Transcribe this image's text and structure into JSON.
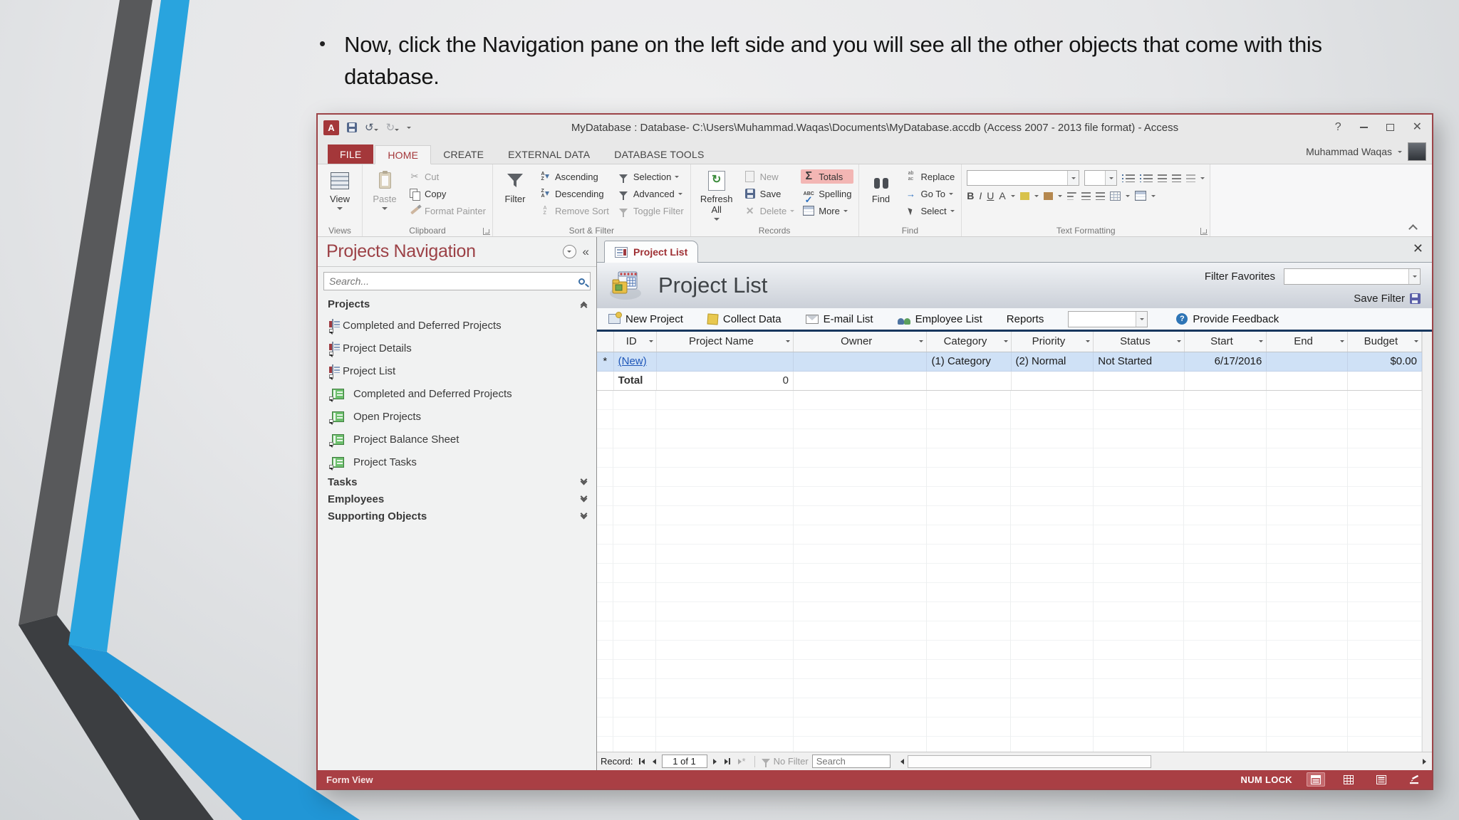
{
  "slide": {
    "bullet_glyph": "•",
    "bullet": "Now, click the Navigation pane on the left side and you will see all the other objects that come with this database."
  },
  "titlebar": {
    "title": "MyDatabase : Database- C:\\Users\\Muhammad.Waqas\\Documents\\MyDatabase.accdb (Access 2007 - 2013 file format) - Access",
    "help": "?"
  },
  "tabs": {
    "file": "FILE",
    "home": "HOME",
    "create": "CREATE",
    "external_data": "EXTERNAL DATA",
    "database_tools": "DATABASE TOOLS"
  },
  "account": {
    "user": "Muhammad Waqas"
  },
  "ribbon": {
    "views": {
      "label": "Views",
      "view": "View"
    },
    "clipboard": {
      "label": "Clipboard",
      "paste": "Paste",
      "cut": "Cut",
      "copy": "Copy",
      "format_painter": "Format Painter"
    },
    "sort_filter": {
      "label": "Sort & Filter",
      "filter": "Filter",
      "ascending": "Ascending",
      "descending": "Descending",
      "remove_sort": "Remove Sort",
      "selection": "Selection",
      "advanced": "Advanced",
      "toggle_filter": "Toggle Filter"
    },
    "records": {
      "label": "Records",
      "refresh_all": "Refresh All",
      "new": "New",
      "save": "Save",
      "delete": "Delete",
      "totals": "Totals",
      "spelling": "Spelling",
      "more": "More"
    },
    "find": {
      "label": "Find",
      "find": "Find",
      "replace": "Replace",
      "goto": "Go To",
      "select": "Select"
    },
    "text_formatting": {
      "label": "Text Formatting"
    }
  },
  "icons": {
    "access_logo": "A",
    "undo": "↺",
    "redo": "↻",
    "cut": "✂",
    "refresh": "↻",
    "sigma": "Σ",
    "abc": "ABC",
    "check": "✓",
    "delete_x": "✕",
    "goto_arrow": "→",
    "bold": "B",
    "italic": "I",
    "underline": "U",
    "font_color": "A",
    "question": "?",
    "pane_collapse": "«",
    "az_a": "A",
    "az_z": "Z"
  },
  "navpane": {
    "title": "Projects Navigation",
    "search_placeholder": "Search...",
    "projects_group": "Projects",
    "items": [
      {
        "label": "Completed and Deferred Projects",
        "icon": "form-icon"
      },
      {
        "label": "Project Details",
        "icon": "form-icon"
      },
      {
        "label": "Project List",
        "icon": "form-icon"
      },
      {
        "label": "Completed and Deferred Projects",
        "icon": "report-icon"
      },
      {
        "label": "Open Projects",
        "icon": "report-icon"
      },
      {
        "label": "Project Balance Sheet",
        "icon": "report-icon"
      },
      {
        "label": "Project Tasks",
        "icon": "report-icon"
      }
    ],
    "tasks_group": "Tasks",
    "employees_group": "Employees",
    "supporting_group": "Supporting Objects"
  },
  "doc": {
    "tab": "Project List",
    "title": "Project List",
    "filter_favorites": "Filter Favorites",
    "save_filter": "Save Filter",
    "close": "✕",
    "toolbar": {
      "new_project": "New Project",
      "collect_data": "Collect Data",
      "email_list": "E-mail List",
      "employee_list": "Employee List",
      "reports": "Reports",
      "provide_feedback": "Provide Feedback"
    },
    "table": {
      "columns": [
        "ID",
        "Project Name",
        "Owner",
        "Category",
        "Priority",
        "Status",
        "Start",
        "End",
        "Budget"
      ],
      "new_row": {
        "indicator": "*",
        "id": "(New)",
        "project_name": "",
        "owner": "",
        "category": "(1) Category",
        "priority": "(2) Normal",
        "status": "Not Started",
        "start": "6/17/2016",
        "end": "",
        "budget": "$0.00"
      },
      "total_row": {
        "label": "Total",
        "count": "0"
      }
    },
    "record_bar": {
      "label": "Record:",
      "position": "1 of 1",
      "no_filter": "No Filter",
      "search_placeholder": "Search"
    }
  },
  "status_bar": {
    "view": "Form View",
    "num_lock": "NUM LOCK"
  },
  "colors": {
    "accent_red": "#a4373a",
    "totals_highlight": "#f3b6b4",
    "selection_blue": "#cfe1f6",
    "stripe_blue": "#29a4de",
    "stripe_gray": "#58595b",
    "toolbar_border_navy": "#17375e"
  }
}
